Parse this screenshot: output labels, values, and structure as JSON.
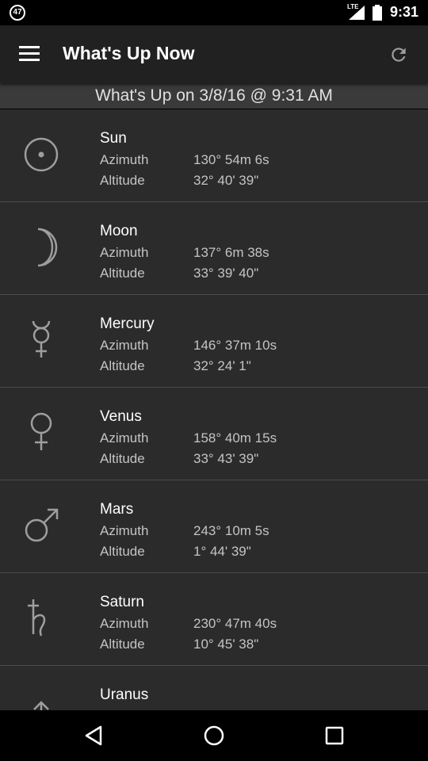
{
  "status_bar": {
    "notification_count": "47",
    "network": "LTE",
    "time": "9:31"
  },
  "app_bar": {
    "title": "What's Up Now"
  },
  "subheader": {
    "text": "What's Up on 3/8/16 @ 9:31 AM"
  },
  "labels": {
    "azimuth": "Azimuth",
    "altitude": "Altitude"
  },
  "bodies": [
    {
      "name": "Sun",
      "icon": "sun-symbol-icon",
      "azimuth": "130° 54m 6s",
      "altitude": "32° 40' 39\""
    },
    {
      "name": "Moon",
      "icon": "moon-symbol-icon",
      "azimuth": "137° 6m 38s",
      "altitude": "33° 39' 40\""
    },
    {
      "name": "Mercury",
      "icon": "mercury-symbol-icon",
      "azimuth": "146° 37m 10s",
      "altitude": "32° 24' 1\""
    },
    {
      "name": "Venus",
      "icon": "venus-symbol-icon",
      "azimuth": "158° 40m 15s",
      "altitude": "33° 43' 39\""
    },
    {
      "name": "Mars",
      "icon": "mars-symbol-icon",
      "azimuth": "243° 10m 5s",
      "altitude": "1° 44' 39\""
    },
    {
      "name": "Saturn",
      "icon": "saturn-symbol-icon",
      "azimuth": "230° 47m 40s",
      "altitude": "10° 45' 38\""
    },
    {
      "name": "Uranus",
      "icon": "uranus-symbol-icon",
      "azimuth": "",
      "altitude": ""
    }
  ],
  "colors": {
    "background": "#2b2b2b",
    "app_bar": "#212121",
    "subheader": "#3a3a3a",
    "text_primary": "#ffffff",
    "text_secondary": "#c4c4c4",
    "icon": "#9e9e9e"
  }
}
